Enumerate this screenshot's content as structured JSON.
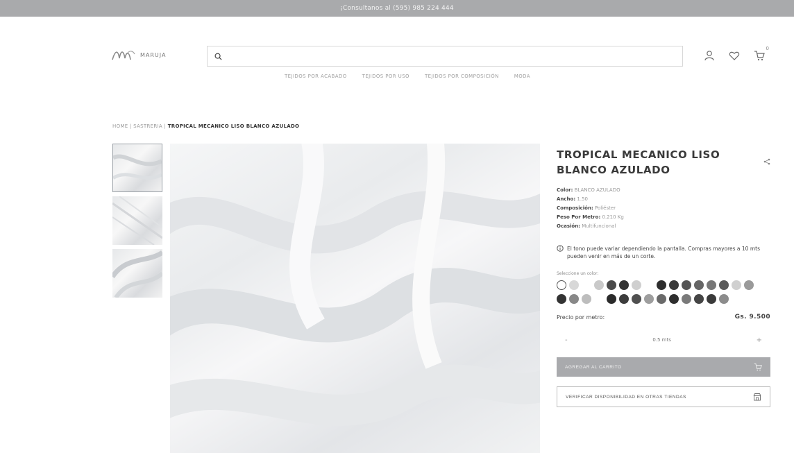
{
  "announcement": "¡Consultanos al (595) 985 224 444",
  "brand": {
    "name": "MARUJA"
  },
  "search": {
    "placeholder": ""
  },
  "header": {
    "cart_count": "0"
  },
  "nav": {
    "items": [
      "TEJIDOS POR ACABADO",
      "TEJIDOS POR USO",
      "TEJIDOS POR COMPOSICIÓN",
      "MODA"
    ]
  },
  "breadcrumb": {
    "home": "HOME",
    "sep": "|",
    "section": "SASTRERIA",
    "current": "TROPICAL MECANICO LISO BLANCO AZULADO"
  },
  "product": {
    "title": "TROPICAL MECANICO LISO BLANCO AZULADO",
    "attributes": [
      {
        "label": "Color:",
        "value": "BLANCO AZULADO"
      },
      {
        "label": "Ancho:",
        "value": "1.50"
      },
      {
        "label": "Composición:",
        "value": "Poliéster"
      },
      {
        "label": "Peso Por Metro:",
        "value": "0.210 Kg"
      },
      {
        "label": "Ocasión:",
        "value": "Multifuncional"
      }
    ],
    "note": "El tono puede variar dependiendo la pantalla. Compras mayores a 10 mts pueden venir en más de un corte.",
    "color_label": "Seleccione un color:",
    "price_label": "Precio por metro:",
    "price": "Gs. 9.500",
    "quantity": {
      "minus": "-",
      "value": "0.5 mts",
      "plus": "+"
    },
    "add_to_cart": "AGREGAR AL CARRITO",
    "verify": "VERIFICAR DISPONIBILIDAD EN OTRAS TIENDAS"
  },
  "swatches": [
    "selected",
    "#d8d8d8",
    "gap",
    "#c9c9c9",
    "#4a4a4a",
    "#333333",
    "#cfcfcf",
    "gap",
    "#2e2e2e",
    "#3a3a3a",
    "#555555",
    "#666666",
    "#777777",
    "#5a5a5a",
    "#d0d0d0",
    "#9a9a9a",
    "#333333",
    "#888888",
    "#bdbdbd",
    "gap",
    "#2b2b2b",
    "#3d3d3d",
    "#505050",
    "#9e9e9e",
    "#6a6a6a",
    "#2f2f2f",
    "#7a7a7a",
    "#454545",
    "#3a3a3a",
    "#8c8c8c"
  ],
  "colors": {
    "topbar": "#a9aaac",
    "button": "#a9aaad",
    "text": "#3a3a3a"
  }
}
